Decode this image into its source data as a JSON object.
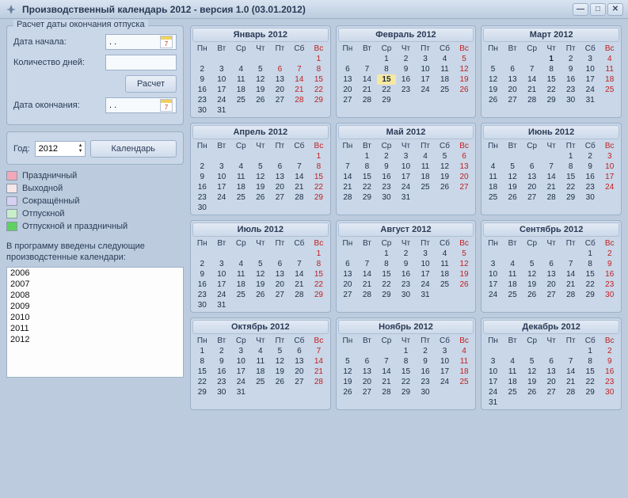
{
  "window": {
    "title": "Производственный календарь 2012 - версия 1.0 (03.01.2012)"
  },
  "vacation": {
    "legend": "Расчет даты окончания отпуска",
    "start_label": "Дата начала:",
    "start_value": "  .  .    ",
    "days_label": "Количество дней:",
    "days_value": "",
    "calc_button": "Расчет",
    "end_label": "Дата окончания:",
    "end_value": "  .  .    ",
    "cal_icon_text": "7"
  },
  "yearbox": {
    "year_label": "Год:",
    "year_value": "2012",
    "calendar_button": "Календарь"
  },
  "legend": {
    "items": [
      {
        "label": "Праздничный",
        "color": "#f2a8b8"
      },
      {
        "label": "Выходной",
        "color": "#f7e6e8"
      },
      {
        "label": "Сокращённый",
        "color": "#d8d0f0"
      },
      {
        "label": "Отпускной",
        "color": "#c8eec8"
      },
      {
        "label": "Отпускной и праздничный",
        "color": "#60d060"
      }
    ]
  },
  "yearlist": {
    "label": "В программу введены следующие производстенные календари:",
    "items": [
      "2006",
      "2007",
      "2008",
      "2009",
      "2010",
      "2011",
      "2012"
    ]
  },
  "dow": [
    "Пн",
    "Вт",
    "Ср",
    "Чт",
    "Пт",
    "Сб",
    "Вс"
  ],
  "months": [
    {
      "title": "Январь 2012",
      "lead": 6,
      "days": 31,
      "hol": [
        1,
        6,
        7,
        8,
        14,
        15,
        21,
        22,
        28,
        29
      ]
    },
    {
      "title": "Февраль 2012",
      "lead": 2,
      "days": 29,
      "hol": [
        5,
        12,
        19,
        26
      ],
      "today": 15
    },
    {
      "title": "Март 2012",
      "lead": 3,
      "days": 31,
      "hol": [
        4,
        11,
        18,
        25
      ],
      "bold": [
        1
      ]
    },
    {
      "title": "Апрель 2012",
      "lead": 6,
      "days": 30,
      "hol": [
        1,
        8,
        15,
        22,
        29
      ]
    },
    {
      "title": "Май 2012",
      "lead": 1,
      "days": 31,
      "hol": [
        6,
        13,
        20,
        27
      ]
    },
    {
      "title": "Июнь 2012",
      "lead": 4,
      "days": 30,
      "hol": [
        3,
        10,
        17,
        24
      ]
    },
    {
      "title": "Июль 2012",
      "lead": 6,
      "days": 31,
      "hol": [
        1,
        8,
        15,
        22,
        29
      ]
    },
    {
      "title": "Август 2012",
      "lead": 2,
      "days": 31,
      "hol": [
        5,
        12,
        19,
        26
      ]
    },
    {
      "title": "Сентябрь 2012",
      "lead": 5,
      "days": 30,
      "hol": [
        2,
        9,
        16,
        23,
        30
      ]
    },
    {
      "title": "Октябрь 2012",
      "lead": 0,
      "days": 31,
      "hol": [
        7,
        14,
        21,
        28
      ]
    },
    {
      "title": "Ноябрь 2012",
      "lead": 3,
      "days": 30,
      "hol": [
        4,
        11,
        18,
        25
      ]
    },
    {
      "title": "Декабрь 2012",
      "lead": 5,
      "days": 31,
      "hol": [
        2,
        9,
        16,
        23,
        30
      ]
    }
  ]
}
